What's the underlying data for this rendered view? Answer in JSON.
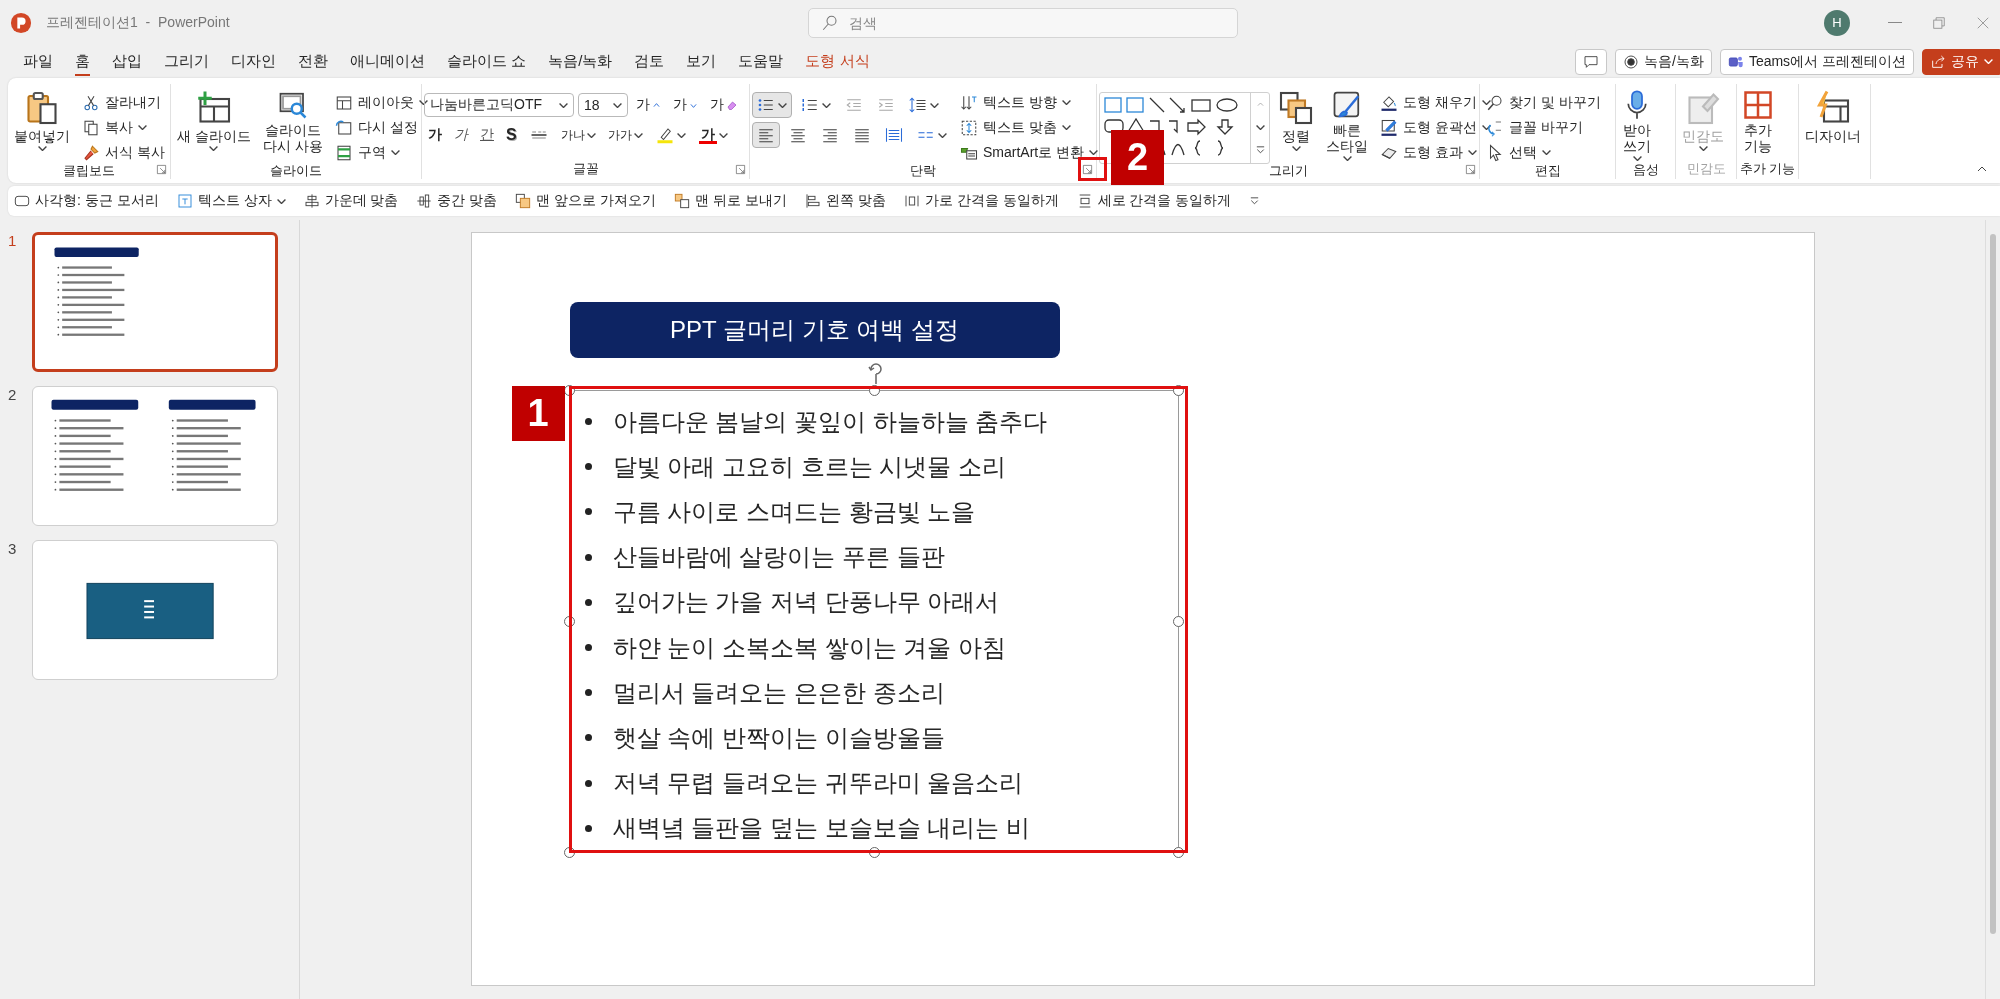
{
  "window": {
    "document_title": "프레젠테이션1",
    "separator": "-",
    "app_name": "PowerPoint",
    "search_placeholder": "검색",
    "avatar_initial": "H"
  },
  "menu_tabs": [
    {
      "label": "파일",
      "selected": false,
      "kind": "normal"
    },
    {
      "label": "홈",
      "selected": true,
      "kind": "normal"
    },
    {
      "label": "삽입",
      "selected": false,
      "kind": "normal"
    },
    {
      "label": "그리기",
      "selected": false,
      "kind": "normal"
    },
    {
      "label": "디자인",
      "selected": false,
      "kind": "normal"
    },
    {
      "label": "전환",
      "selected": false,
      "kind": "normal"
    },
    {
      "label": "애니메이션",
      "selected": false,
      "kind": "normal"
    },
    {
      "label": "슬라이드 쇼",
      "selected": false,
      "kind": "normal"
    },
    {
      "label": "녹음/녹화",
      "selected": false,
      "kind": "normal"
    },
    {
      "label": "검토",
      "selected": false,
      "kind": "normal"
    },
    {
      "label": "보기",
      "selected": false,
      "kind": "normal"
    },
    {
      "label": "도움말",
      "selected": false,
      "kind": "normal"
    },
    {
      "label": "도형 서식",
      "selected": false,
      "kind": "contextual"
    }
  ],
  "menu_actions": [
    {
      "kind": "comment"
    },
    {
      "kind": "record",
      "label": "녹음/녹화"
    },
    {
      "kind": "teams",
      "label": "Teams에서 프레젠테이션"
    },
    {
      "kind": "share",
      "label": "공유",
      "dropdown": true
    }
  ],
  "ribbon_groups": [
    {
      "label": "클립보드",
      "launcher": true,
      "disabled": false,
      "controls": [
        {
          "kind": "large",
          "lines": [
            "붙여넣기"
          ],
          "dropdown": true
        },
        {
          "kind": "small",
          "label": "잘라내기"
        },
        {
          "kind": "small",
          "label": "복사",
          "dropdown": true
        },
        {
          "kind": "small",
          "label": "서식 복사"
        }
      ]
    },
    {
      "label": "슬라이드",
      "launcher": false,
      "disabled": false,
      "controls": [
        {
          "kind": "large",
          "lines": [
            "새 슬라이드"
          ],
          "dropdown": true
        },
        {
          "kind": "large",
          "lines": [
            "슬라이드",
            "다시 사용"
          ]
        },
        {
          "kind": "small",
          "label": "레이아웃",
          "dropdown": true
        },
        {
          "kind": "small",
          "label": "다시 설정"
        },
        {
          "kind": "small",
          "label": "구역",
          "dropdown": true
        }
      ]
    },
    {
      "label": "글꼴",
      "launcher": true,
      "disabled": false,
      "controls": [
        {
          "kind": "combo",
          "value": "나눔바른고딕OTF"
        },
        {
          "kind": "combo",
          "value": "18"
        },
        {
          "kind": "glyph",
          "label": "가"
        },
        {
          "kind": "glyph",
          "label": "가"
        },
        {
          "kind": "glyph",
          "label": "가"
        },
        {
          "kind": "glyph",
          "label": "가"
        },
        {
          "kind": "glyph",
          "label": "가"
        },
        {
          "kind": "glyph",
          "label": "간"
        },
        {
          "kind": "glyph",
          "label": "S"
        },
        {
          "kind": "icon"
        },
        {
          "kind": "glyph",
          "label": "가나",
          "dropdown": true
        },
        {
          "kind": "glyph",
          "label": "가가",
          "dropdown": true
        },
        {
          "kind": "icon",
          "dropdown": true
        },
        {
          "kind": "glyph",
          "label": "가",
          "dropdown": true
        }
      ]
    },
    {
      "label": "단락",
      "launcher": true,
      "disabled": false,
      "controls": [
        {
          "kind": "icon",
          "dropdown": true,
          "selected": true
        },
        {
          "kind": "icon",
          "dropdown": true,
          "selected": false
        },
        {
          "kind": "icon"
        },
        {
          "kind": "icon"
        },
        {
          "kind": "icon",
          "dropdown": true
        },
        {
          "kind": "icon",
          "selected": true
        },
        {
          "kind": "icon",
          "selected": false
        },
        {
          "kind": "icon",
          "selected": false
        },
        {
          "kind": "icon",
          "selected": false
        },
        {
          "kind": "icon",
          "selected": false
        },
        {
          "kind": "icon",
          "dropdown": true
        },
        {
          "kind": "small",
          "label": "텍스트 방향",
          "dropdown": true
        },
        {
          "kind": "small",
          "label": "텍스트 맞춤",
          "dropdown": true
        },
        {
          "kind": "small",
          "label": "SmartArt로 변환",
          "dropdown": true
        }
      ]
    },
    {
      "label": "그리기",
      "launcher": true,
      "disabled": false,
      "controls": [
        {
          "kind": "gallery"
        },
        {
          "kind": "large",
          "lines": [
            "정렬"
          ],
          "dropdown": true
        },
        {
          "kind": "large",
          "lines": [
            "빠른",
            "스타일"
          ],
          "dropdown": true
        },
        {
          "kind": "small",
          "label": "도형 채우기",
          "dropdown": true
        },
        {
          "kind": "small",
          "label": "도형 윤곽선",
          "dropdown": true
        },
        {
          "kind": "small",
          "label": "도형 효과",
          "dropdown": true
        }
      ]
    },
    {
      "label": "편집",
      "launcher": false,
      "disabled": false,
      "controls": [
        {
          "kind": "small",
          "label": "찾기 및 바꾸기"
        },
        {
          "kind": "small",
          "label": "글꼴 바꾸기"
        },
        {
          "kind": "small",
          "label": "선택",
          "dropdown": true
        }
      ]
    },
    {
      "label": "음성",
      "launcher": false,
      "disabled": false,
      "controls": [
        {
          "kind": "large",
          "lines": [
            "받아",
            "쓰기"
          ],
          "dropdown": true
        }
      ]
    },
    {
      "label": "민감도",
      "launcher": false,
      "disabled": true,
      "controls": [
        {
          "kind": "large",
          "lines": [
            "민감도"
          ],
          "dropdown": true
        }
      ]
    },
    {
      "label": "추가 기능",
      "launcher": false,
      "disabled": false,
      "controls": [
        {
          "kind": "large",
          "lines": [
            "추가",
            "기능"
          ]
        }
      ]
    },
    {
      "launcher": false,
      "disabled": false,
      "controls": [
        {
          "kind": "large",
          "lines": [
            "디자이너"
          ]
        }
      ]
    }
  ],
  "format_bar": [
    {
      "label": "사각형: 둥근 모서리"
    },
    {
      "label": "텍스트 상자",
      "dropdown": true
    },
    {
      "label": "가운데 맞춤"
    },
    {
      "label": "중간 맞춤"
    },
    {
      "label": "맨 앞으로 가져오기"
    },
    {
      "label": "맨 뒤로 보내기"
    },
    {
      "label": "왼쪽 맞춤"
    },
    {
      "label": "가로 간격을 동일하게"
    },
    {
      "label": "세로 간격을 동일하게"
    }
  ],
  "thumbnails": [
    {
      "number": "1",
      "selected": true,
      "kind": "title-list"
    },
    {
      "number": "2",
      "selected": false,
      "kind": "two-column"
    },
    {
      "number": "3",
      "selected": false,
      "kind": "box"
    }
  ],
  "slide": {
    "title": "PPT 글머리 기호 여백 설정",
    "text_box": {
      "selected": true,
      "bullets": [
        "아름다운 봄날의 꽃잎이 하늘하늘 춤추다",
        "달빛 아래 고요히 흐르는 시냇물 소리",
        "구름 사이로 스며드는 황금빛 노을",
        "산들바람에 살랑이는 푸른 들판",
        "깊어가는 가을 저녁 단풍나무 아래서",
        "하얀 눈이 소복소복 쌓이는 겨울 아침",
        "멀리서 들려오는 은은한 종소리",
        "햇살 속에 반짝이는 이슬방울들",
        "저녁 무렵 들려오는 귀뚜라미 울음소리",
        "새벽녘 들판을 덮는 보슬보슬 내리는 비"
      ]
    }
  },
  "annotations": [
    {
      "label": "1"
    },
    {
      "label": "2"
    }
  ]
}
